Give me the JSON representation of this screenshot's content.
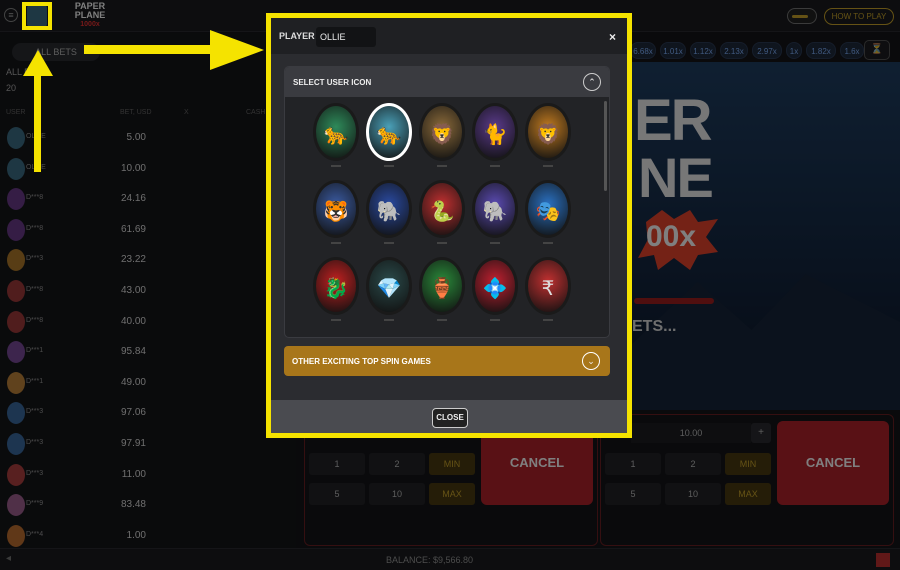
{
  "topbar": {
    "menu_icon": "hamburger-icon",
    "logo_line1": "PAPER",
    "logo_line2": "PLANE",
    "logo_sub": "1000x",
    "how_to_play": "HOW TO PLAY"
  },
  "left": {
    "tab_all_bets": "ALL BETS",
    "title": "ALL BETS",
    "count": "20",
    "columns": [
      "USER",
      "BET, USD",
      "X",
      "CASH OUT"
    ],
    "rows": [
      {
        "name": "OLLIE",
        "bet": "5.00",
        "color": "#3d6f86"
      },
      {
        "name": "OLLIE",
        "bet": "10.00",
        "color": "#3d6f86"
      },
      {
        "name": "D***8",
        "bet": "24.16",
        "color": "#6a3a8a"
      },
      {
        "name": "D***8",
        "bet": "61.69",
        "color": "#6a3a8a"
      },
      {
        "name": "D***3",
        "bet": "23.22",
        "color": "#b07a2a"
      },
      {
        "name": "D***8",
        "bet": "43.00",
        "color": "#a03a3a"
      },
      {
        "name": "D***8",
        "bet": "40.00",
        "color": "#a03a3a"
      },
      {
        "name": "D***1",
        "bet": "95.84",
        "color": "#7a4a9a"
      },
      {
        "name": "D***1",
        "bet": "49.00",
        "color": "#c0843a"
      },
      {
        "name": "D***3",
        "bet": "97.06",
        "color": "#3a6aa0"
      },
      {
        "name": "D***3",
        "bet": "97.91",
        "color": "#3a6aa0"
      },
      {
        "name": "D***3",
        "bet": "11.00",
        "color": "#b04040"
      },
      {
        "name": "D***9",
        "bet": "83.48",
        "color": "#a06090"
      },
      {
        "name": "D***4",
        "bet": "1.00",
        "color": "#c07030"
      }
    ]
  },
  "multipliers": [
    "6.68x",
    "1.01x",
    "1.12x",
    "2.13x",
    "2.97x",
    "1x",
    "1.82x",
    "1.6x"
  ],
  "hourglass_icon": "hourglass-icon",
  "game": {
    "line1": "ER",
    "line2": "NE",
    "burst": "00x",
    "bets_text": "ETS..."
  },
  "bet_panel_1": {
    "quick": [
      "1",
      "2",
      "MIN",
      "5",
      "10",
      "MAX"
    ],
    "cancel": "CANCEL"
  },
  "bet_panel_2": {
    "amount": "10.00",
    "plus": "+",
    "quick": [
      "1",
      "2",
      "MIN",
      "5",
      "10",
      "MAX"
    ],
    "cancel": "CANCEL"
  },
  "bottom": {
    "balance": "BALANCE: $9,566.80"
  },
  "modal": {
    "player_label": "PLAYER",
    "player_name": "OLLIE",
    "close_x": "×",
    "select_icon_title": "SELECT USER ICON",
    "other_games_title": "OTHER EXCITING TOP SPIN GAMES",
    "close_button": "CLOSE",
    "icons": [
      {
        "name": "cougar-icon",
        "bg": "#2e8a5a",
        "glyph": "🐆"
      },
      {
        "name": "snow-leopard-icon",
        "bg": "#4aa0b8",
        "glyph": "🐆",
        "selected": true
      },
      {
        "name": "lioness-icon",
        "bg": "#8a6a3a",
        "glyph": "🦁"
      },
      {
        "name": "panther-icon",
        "bg": "#5a3a8a",
        "glyph": "🐈"
      },
      {
        "name": "lion-icon",
        "bg": "#c07a20",
        "glyph": "🦁"
      },
      {
        "name": "tiger-icon",
        "bg": "#3a5aa0",
        "glyph": "🐯"
      },
      {
        "name": "golden-elephant-icon",
        "bg": "#2a4aa0",
        "glyph": "🐘"
      },
      {
        "name": "snake-icon",
        "bg": "#c03030",
        "glyph": "🐍"
      },
      {
        "name": "white-elephant-icon",
        "bg": "#5a4ab0",
        "glyph": "🐘"
      },
      {
        "name": "carnival-mask-icon",
        "bg": "#2a70c0",
        "glyph": "🎭"
      },
      {
        "name": "dragon-icon",
        "bg": "#c02020",
        "glyph": "🐉"
      },
      {
        "name": "diamond-icon",
        "bg": "#2a4a4a",
        "glyph": "💎"
      },
      {
        "name": "lucky-pot-icon",
        "bg": "#2a8a3a",
        "glyph": "🏺"
      },
      {
        "name": "blue-gem-icon",
        "bg": "#c02030",
        "glyph": "💠"
      },
      {
        "name": "rupee-coin-icon",
        "bg": "#c03030",
        "glyph": "₹"
      }
    ]
  }
}
